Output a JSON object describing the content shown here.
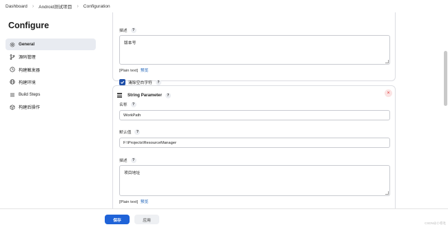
{
  "breadcrumb": [
    "Dashboard",
    "Android测试项目",
    "Configuration"
  ],
  "sidebar": {
    "title": "Configure",
    "items": [
      {
        "label": "General",
        "icon": "gear-icon",
        "active": true
      },
      {
        "label": "源码管理",
        "icon": "branch-icon"
      },
      {
        "label": "构建触发器",
        "icon": "clock-icon"
      },
      {
        "label": "构建环境",
        "icon": "globe-icon"
      },
      {
        "label": "Build Steps",
        "icon": "list-icon"
      },
      {
        "label": "构建后操作",
        "icon": "cube-icon"
      }
    ]
  },
  "card1": {
    "desc_label": "描述",
    "desc_value": "版本号",
    "plain_text": "[Plain text]",
    "preview": "预览",
    "trim_label": "清除空白字符"
  },
  "card2": {
    "title": "String Parameter",
    "name_label": "名称",
    "name_value": "WorkPath",
    "default_label": "默认值",
    "default_value": "F:\\Projects\\ResourceManager",
    "desc_label": "描述",
    "desc_value": "项目地址",
    "plain_text": "[Plain text]",
    "preview": "预览"
  },
  "help_mark": "?",
  "buttons": {
    "save": "保存",
    "apply": "应用"
  },
  "watermark": "CSDN@小卷毛",
  "colors": {
    "primary": "#1f63d8",
    "link": "#1d62b8",
    "checkbox": "#1d4ea8"
  }
}
